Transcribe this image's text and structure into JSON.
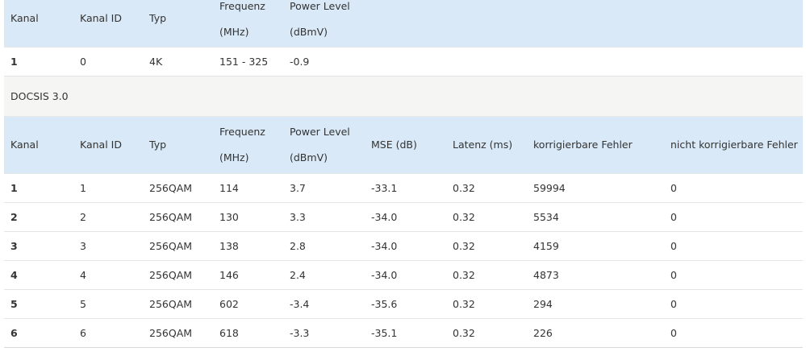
{
  "downstream_ofdm": {
    "headers": {
      "kanal": "Kanal",
      "kanal_id": "Kanal ID",
      "typ": "Typ",
      "frequenz": "Frequenz",
      "frequenz_unit": "(MHz)",
      "power_level": "Power Level",
      "power_unit": "(dBmV)"
    },
    "rows": [
      {
        "kanal": "1",
        "kanal_id": "0",
        "typ": "4K",
        "frequenz": "151 - 325",
        "power_level": "-0.9"
      }
    ]
  },
  "docsis30": {
    "section_label": "DOCSIS 3.0",
    "headers": {
      "kanal": "Kanal",
      "kanal_id": "Kanal ID",
      "typ": "Typ",
      "frequenz": "Frequenz",
      "frequenz_unit": "(MHz)",
      "power_level": "Power Level",
      "power_unit": "(dBmV)",
      "mse": "MSE (dB)",
      "latenz": "Latenz (ms)",
      "korrigierbar": "korrigierbare Fehler",
      "nicht_korrigierbar": "nicht korrigierbare Fehler"
    },
    "rows": [
      {
        "kanal": "1",
        "kanal_id": "1",
        "typ": "256QAM",
        "frequenz": "114",
        "power_level": "3.7",
        "mse": "-33.1",
        "latenz": "0.32",
        "korrigierbar": "59994",
        "nicht_korrigierbar": "0"
      },
      {
        "kanal": "2",
        "kanal_id": "2",
        "typ": "256QAM",
        "frequenz": "130",
        "power_level": "3.3",
        "mse": "-34.0",
        "latenz": "0.32",
        "korrigierbar": "5534",
        "nicht_korrigierbar": "0"
      },
      {
        "kanal": "3",
        "kanal_id": "3",
        "typ": "256QAM",
        "frequenz": "138",
        "power_level": "2.8",
        "mse": "-34.0",
        "latenz": "0.32",
        "korrigierbar": "4159",
        "nicht_korrigierbar": "0"
      },
      {
        "kanal": "4",
        "kanal_id": "4",
        "typ": "256QAM",
        "frequenz": "146",
        "power_level": "2.4",
        "mse": "-34.0",
        "latenz": "0.32",
        "korrigierbar": "4873",
        "nicht_korrigierbar": "0"
      },
      {
        "kanal": "5",
        "kanal_id": "5",
        "typ": "256QAM",
        "frequenz": "602",
        "power_level": "-3.4",
        "mse": "-35.6",
        "latenz": "0.32",
        "korrigierbar": "294",
        "nicht_korrigierbar": "0"
      },
      {
        "kanal": "6",
        "kanal_id": "6",
        "typ": "256QAM",
        "frequenz": "618",
        "power_level": "-3.3",
        "mse": "-35.1",
        "latenz": "0.32",
        "korrigierbar": "226",
        "nicht_korrigierbar": "0"
      }
    ]
  }
}
